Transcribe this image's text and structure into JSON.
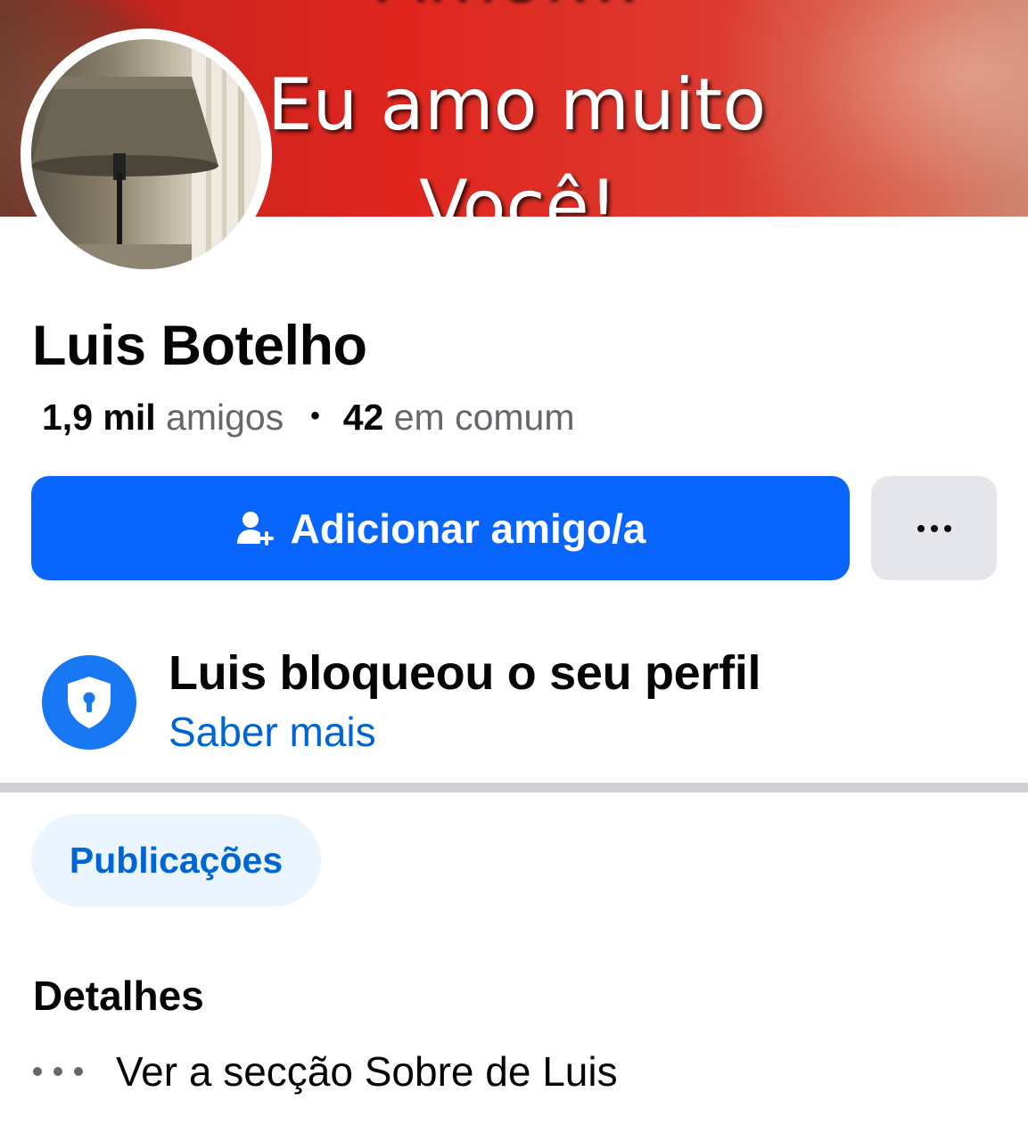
{
  "cover": {
    "text_top": "Amor...",
    "text_mid": "Eu amo muito",
    "text_bot": "Você!"
  },
  "profile": {
    "name": "Luis Botelho",
    "friends_count": "1,9 mil",
    "friends_label": "amigos",
    "separator": "•",
    "mutual_count": "42",
    "mutual_label": "em comum"
  },
  "actions": {
    "add_friend_label": "Adicionar amigo/a",
    "more_icon": "ellipsis-icon"
  },
  "locked": {
    "title": "Luis bloqueou o seu perfil",
    "learn_more": "Saber mais",
    "icon": "shield-lock-icon"
  },
  "tabs": {
    "posts": "Publicações"
  },
  "details": {
    "title": "Detalhes",
    "about_link": "Ver a secção Sobre de Luis"
  },
  "colors": {
    "primary": "#0866ff",
    "link": "#0064d1",
    "chip_bg": "#ebf5ff",
    "secondary_btn": "#e4e6eb",
    "divider": "#ced0d4",
    "text": "#050505",
    "muted": "#65676b"
  }
}
